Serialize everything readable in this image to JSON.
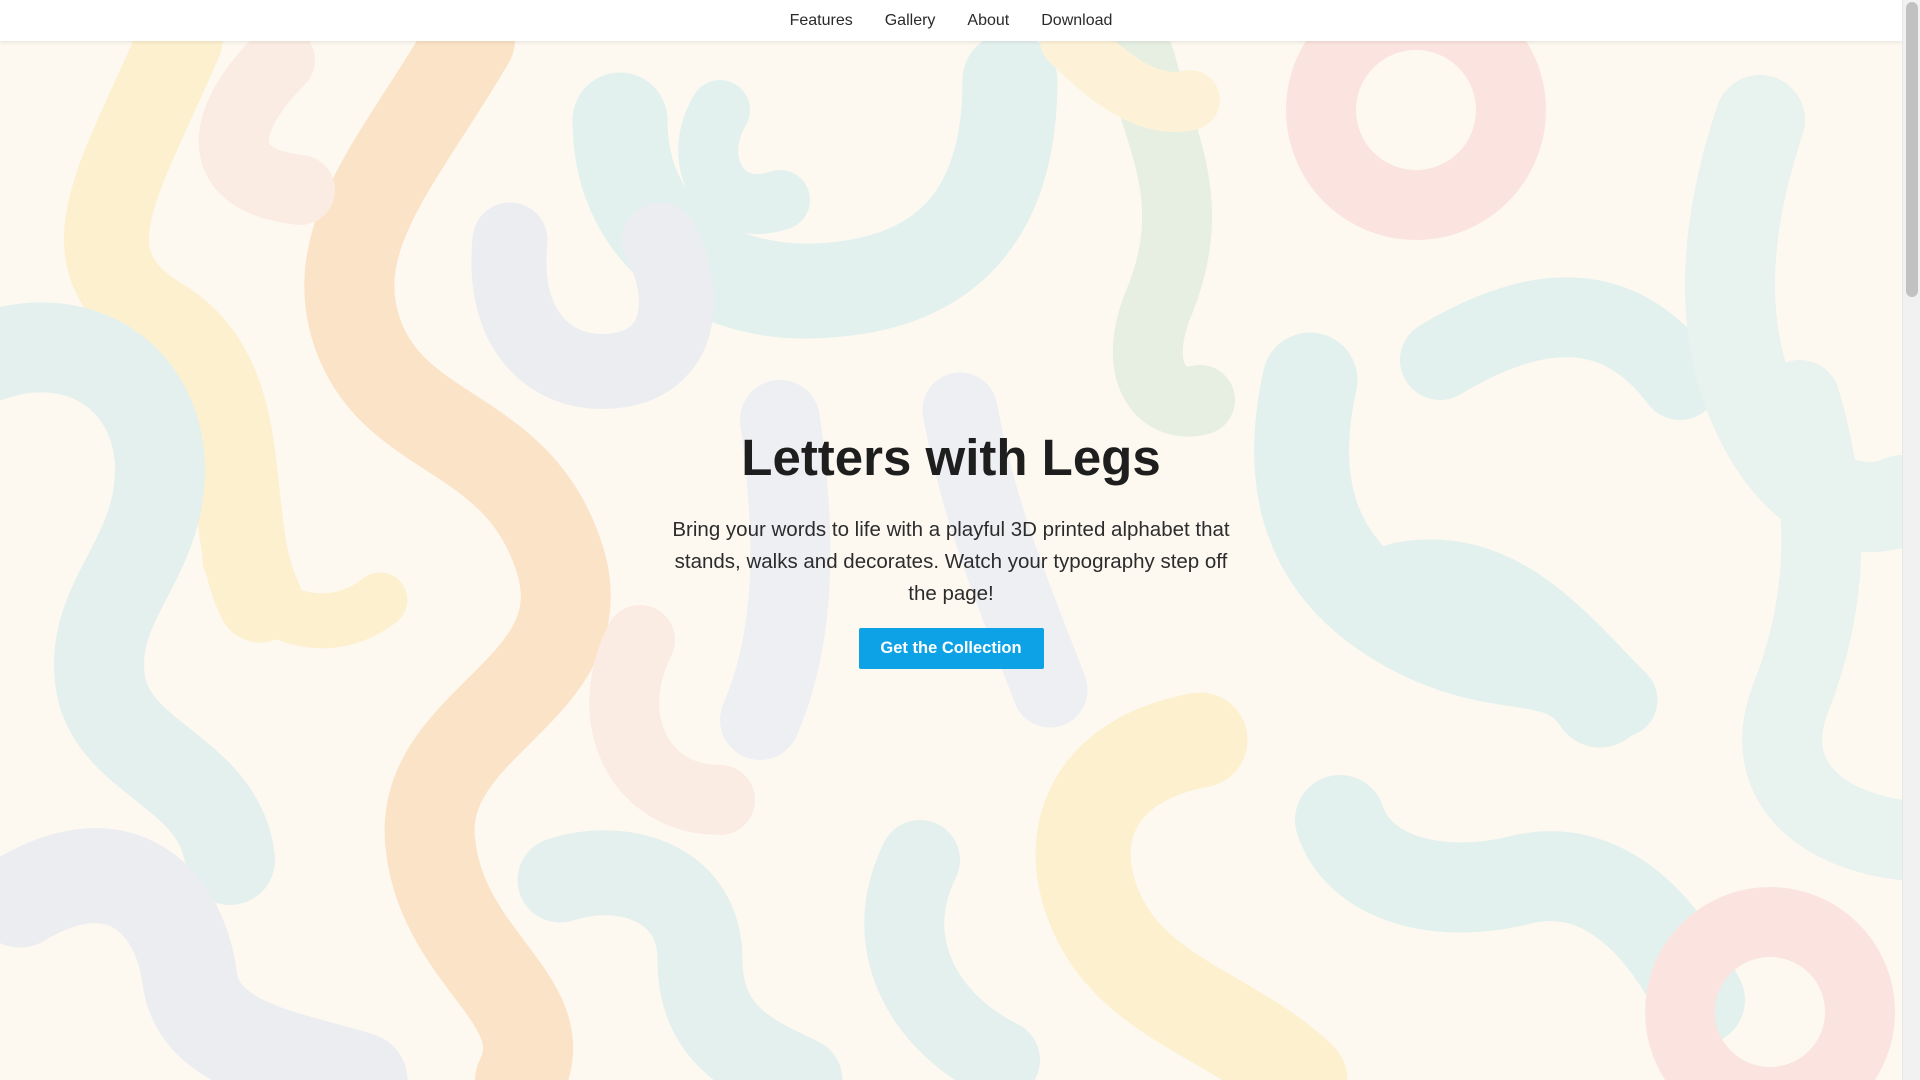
{
  "nav": {
    "items": [
      {
        "label": "Features"
      },
      {
        "label": "Gallery"
      },
      {
        "label": "About"
      },
      {
        "label": "Download"
      }
    ]
  },
  "hero": {
    "title": "Letters with Legs",
    "subtitle": "Bring your words to life with a playful 3D printed alphabet that stands, walks and decorates. Watch your typography step off the page!",
    "cta_label": "Get the Collection"
  },
  "colors": {
    "background": "#fdf9f1",
    "accent": "#0da2e6",
    "blob_teal": "#e3f1ee",
    "blob_orange": "#fbe6cd",
    "blob_yellow": "#fdf0cf",
    "blob_pink": "#fbe4df",
    "blob_lavender": "#ecedf1",
    "blob_peach": "#fbece3"
  }
}
